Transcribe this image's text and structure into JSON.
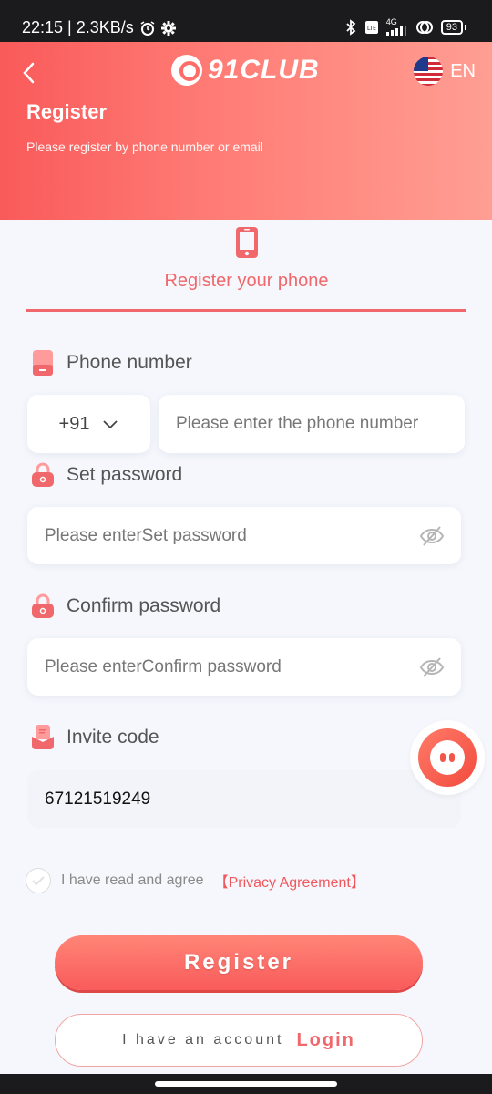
{
  "status_bar": {
    "time_speed": "22:15 | 2.3KB/s",
    "network": "4G",
    "battery": "93",
    "icons": [
      "alarm-icon",
      "settings-icon",
      "bluetooth-icon",
      "volte-icon",
      "signal-icon",
      "hotspot-icon",
      "battery-icon"
    ]
  },
  "header": {
    "brand": "91CLUB",
    "language": "EN",
    "title": "Register",
    "subtitle": "Please register by phone number or email"
  },
  "tab": {
    "label": "Register your phone",
    "icon": "phone-icon"
  },
  "form": {
    "phone": {
      "label": "Phone number",
      "country_code": "+91",
      "placeholder": "Please enter the phone number",
      "value": ""
    },
    "password": {
      "label": "Set password",
      "placeholder": "Please enterSet password",
      "value": ""
    },
    "confirm": {
      "label": "Confirm password",
      "placeholder": "Please enterConfirm password",
      "value": ""
    },
    "invite": {
      "label": "Invite code",
      "value": "67121519249"
    }
  },
  "agreement": {
    "text": "I have read and agree",
    "link": "【Privacy Agreement】",
    "checked": false
  },
  "buttons": {
    "register": "Register",
    "have_account": "I have an account",
    "login": "Login"
  },
  "colors": {
    "accent": "#f0686b",
    "header_start": "#f95a5a",
    "header_end": "#ff9e93",
    "background": "#f6f7fc"
  }
}
